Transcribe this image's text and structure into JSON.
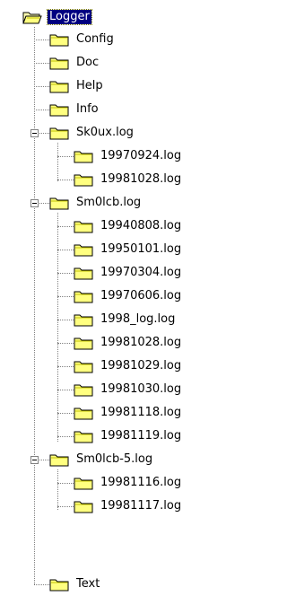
{
  "tree": {
    "root": {
      "label": "Logger",
      "selected": true
    },
    "children": [
      {
        "label": "Config"
      },
      {
        "label": "Doc"
      },
      {
        "label": "Help"
      },
      {
        "label": "Info"
      },
      {
        "label": "Sk0ux.log",
        "expanded": true,
        "children": [
          {
            "label": "19970924.log"
          },
          {
            "label": "19981028.log"
          }
        ]
      },
      {
        "label": "Sm0lcb.log",
        "expanded": true,
        "children": [
          {
            "label": "19940808.log"
          },
          {
            "label": "19950101.log"
          },
          {
            "label": "19970304.log"
          },
          {
            "label": "19970606.log"
          },
          {
            "label": "1998_log.log"
          },
          {
            "label": "19981028.log"
          },
          {
            "label": "19981029.log"
          },
          {
            "label": "19981030.log"
          },
          {
            "label": "19981118.log"
          },
          {
            "label": "19981119.log"
          }
        ]
      },
      {
        "label": "Sm0lcb-5.log",
        "expanded": true,
        "children": [
          {
            "label": "19981116.log"
          },
          {
            "label": "19981117.log"
          }
        ]
      },
      {
        "label": "Text"
      }
    ]
  },
  "colors": {
    "selection_bg": "#000080",
    "selection_fg": "#ffffff",
    "folder_fill": "#ffff80",
    "folder_shade": "#c0c000",
    "folder_outline": "#000000",
    "tree_line": "#808080"
  },
  "icons": {
    "folder": "folder-icon",
    "open_folder": "open-folder-icon",
    "expanded_toggle": "minus-box-icon"
  }
}
